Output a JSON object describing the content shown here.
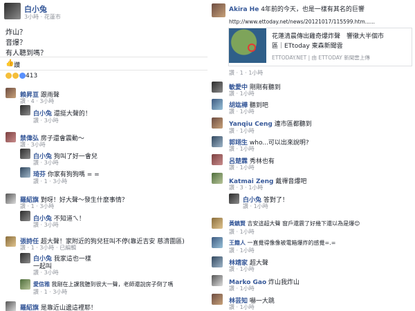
{
  "left_post": {
    "author": "白小兔",
    "meta": "3小時 · 花蓮市",
    "lines": [
      "炸山？",
      "音爆？",
      "有人聽到嗎？"
    ],
    "actions": {
      "comment": "讚"
    },
    "reactions": "413",
    "comments": [
      {
        "name": "賴昇亘",
        "text": "跟雨聲",
        "meta": "讚 · 4 · 3小時"
      },
      {
        "name": "白小兔",
        "text": "還挺大聲的！",
        "meta": "讚 · 3小時"
      },
      {
        "name": "禁偉弘",
        "text": "房子還會震動～",
        "meta": "讚 · 3小時"
      },
      {
        "name": "白小兔",
        "text": "狗叫了好一會兒",
        "meta": "讚 · 3小時"
      },
      {
        "name": "琦芬",
        "text": "你家有狗狗嗎 = =",
        "meta": "讚 · 1 · 3小時"
      },
      {
        "name": "羅紹旗",
        "text": "對呀！好大聲～發生什麼事情？",
        "meta": "讚 · 1 · 3小時"
      },
      {
        "name": "白小兔",
        "text": "不知道ㄟ！",
        "meta": "讚 · 3小時"
      },
      {
        "name": "張詩任",
        "text": "超大聲！家附近的狗兒狂叫不停(靠近吉安 慈濟圍區)",
        "meta": "讚 · 1 · 3小時 · 已編輯"
      },
      {
        "name": "白小兔",
        "text": "我家這也一樣",
        "extra": "一起叫",
        "meta": "讚 · 3小時"
      },
      {
        "name": "愛信雅",
        "text": "我剛在上課我聽到很大一聲，老師還說房子倒了嗎",
        "meta": "讚 · 1 · 3小時"
      },
      {
        "name": "羅紹旗",
        "text": "是靠近山邊這裡耶！"
      }
    ]
  },
  "right_post": {
    "author": "Akira He",
    "header_text": "4年前的今天，也是一樣有其名的巨響",
    "url": "http://www.ettoday.net/news/20121017/115599.htm......",
    "preview_title_1": "花蓮清晨傳出雞奇爆炸聲　響徹大半個市",
    "preview_title_2": "區｜ETtoday 東森新聞雲",
    "preview_source": "ETTODAY.NET | 由 ETTODAY 新聞雲上傳",
    "post_meta": "讚 · 1 · 1小時",
    "comments": [
      {
        "name": "敏愛中",
        "text": "剛剛有聽到",
        "meta": "讚 · 1小時"
      },
      {
        "name": "胡竑樺",
        "text": "聽到吧",
        "meta": "讚 · 1小時"
      },
      {
        "name": "Yanqiu Ceng",
        "text": "連市區都聽到",
        "meta": "讚 · 1小時"
      },
      {
        "name": "郭翊生",
        "text": "who...可以出來說明?",
        "meta": "讚 · 1小時"
      },
      {
        "name": "呂楚霖",
        "text": "秀林也有",
        "meta": "讚 · 1小時"
      },
      {
        "name": "Katmai Zeng",
        "text": "戴禪音爆吧",
        "meta": "讚 · 3 · 1小時"
      },
      {
        "name": "白小兔",
        "text": "答對了！",
        "meta": "讚 · 1小時"
      },
      {
        "name": "黃鎮賢",
        "text": "吉安這超大聲 窗戶還震了好幾下還以為是爆😊",
        "meta": "讚 · 1小時"
      },
      {
        "name": "王籍人",
        "text": "一直覺得像像被電箱爆炸的感覺=.=",
        "meta": "讚 · 1小時"
      },
      {
        "name": "林靖家",
        "text": "超大聲",
        "meta": "讚 · 1小時"
      },
      {
        "name": "Marko Gao",
        "text": "炸山我炸山",
        "meta": "讚 · 1小時"
      },
      {
        "name": "林芸知",
        "text": "嚇一大跳",
        "meta": "讚 · 1小時"
      }
    ]
  },
  "colors": {
    "link": "#365899",
    "meta": "#90949c",
    "accent": "#4267b2"
  }
}
